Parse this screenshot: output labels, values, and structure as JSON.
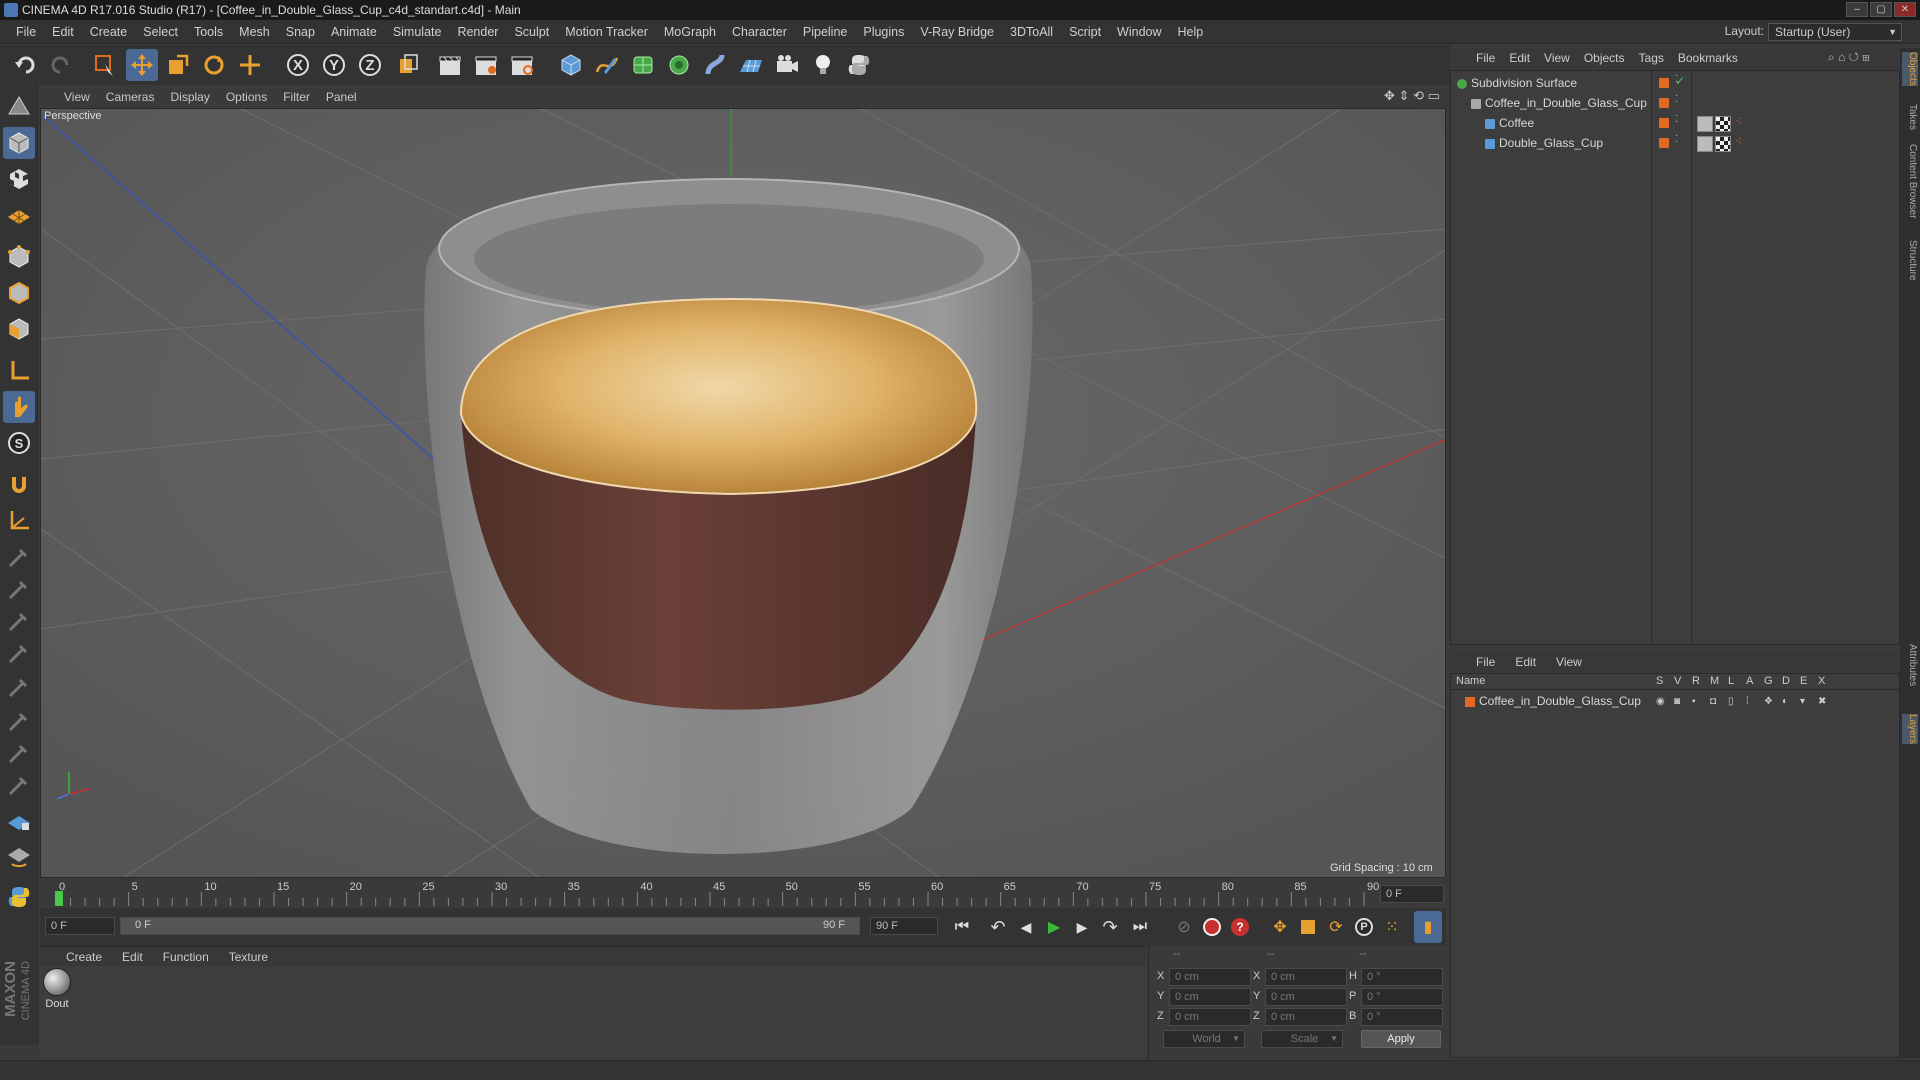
{
  "window": {
    "title": "CINEMA 4D R17.016 Studio (R17) - [Coffee_in_Double_Glass_Cup_c4d_standart.c4d] - Main",
    "controls": [
      "–",
      "▢",
      "✕"
    ]
  },
  "menubar": {
    "items": [
      "File",
      "Edit",
      "Create",
      "Select",
      "Tools",
      "Mesh",
      "Snap",
      "Animate",
      "Simulate",
      "Render",
      "Sculpt",
      "Motion Tracker",
      "MoGraph",
      "Character",
      "Pipeline",
      "Plugins",
      "V-Ray Bridge",
      "3DToAll",
      "Script",
      "Window",
      "Help"
    ],
    "layout_label": "Layout:",
    "layout_value": "Startup (User)"
  },
  "toolbar": {
    "axis_labels": [
      "X",
      "Y",
      "Z"
    ]
  },
  "viewport": {
    "menu": [
      "View",
      "Cameras",
      "Display",
      "Options",
      "Filter",
      "Panel"
    ],
    "label": "Perspective",
    "grid_spacing": "Grid Spacing : 10 cm"
  },
  "timeline": {
    "ticks": [
      "0",
      "5",
      "10",
      "15",
      "20",
      "25",
      "30",
      "35",
      "40",
      "45",
      "50",
      "55",
      "60",
      "65",
      "70",
      "75",
      "80",
      "85",
      "90"
    ],
    "current_frame": "0 F",
    "start_field": "0 F",
    "range_start": "0 F",
    "range_end": "90 F",
    "end_field": "90 F"
  },
  "materials": {
    "menu": [
      "Create",
      "Edit",
      "Function",
      "Texture"
    ],
    "items": [
      {
        "label": "Dout"
      }
    ]
  },
  "coordinates": {
    "headers": [
      "--",
      "--",
      "--"
    ],
    "rows": [
      {
        "a": "X",
        "av": "0 cm",
        "b": "X",
        "bv": "0 cm",
        "c": "H",
        "cv": "0 °"
      },
      {
        "a": "Y",
        "av": "0 cm",
        "b": "Y",
        "bv": "0 cm",
        "c": "P",
        "cv": "0 °"
      },
      {
        "a": "Z",
        "av": "0 cm",
        "b": "Z",
        "bv": "0 cm",
        "c": "B",
        "cv": "0 °"
      }
    ],
    "mode1": "World",
    "mode2": "Scale",
    "apply": "Apply"
  },
  "object_manager": {
    "menu": [
      "File",
      "Edit",
      "View",
      "Objects",
      "Tags",
      "Bookmarks"
    ],
    "tree": [
      {
        "name": "Subdivision Surface",
        "depth": 0
      },
      {
        "name": "Coffee_in_Double_Glass_Cup",
        "depth": 1
      },
      {
        "name": "Coffee",
        "depth": 2
      },
      {
        "name": "Double_Glass_Cup",
        "depth": 2
      }
    ]
  },
  "layer_manager": {
    "menu": [
      "File",
      "Edit",
      "View"
    ],
    "col_name": "Name",
    "cols": [
      "S",
      "V",
      "R",
      "M",
      "L",
      "A",
      "G",
      "D",
      "E",
      "X"
    ],
    "layers": [
      {
        "name": "Coffee_in_Double_Glass_Cup",
        "color": "#e06a20"
      }
    ]
  },
  "side_tabs": [
    "Objects",
    "Takes",
    "Content Browser",
    "Structure",
    "Attributes",
    "Layers"
  ],
  "brand": {
    "line1": "MAXON",
    "line2": "CINEMA 4D"
  },
  "colors": {
    "accent_orange": "#e06a20",
    "axis_x": "#c83030",
    "axis_y": "#30a030",
    "axis_z": "#3050c8",
    "coffee_foam": "#d9a24f",
    "cup_inner": "#5e3a33"
  }
}
